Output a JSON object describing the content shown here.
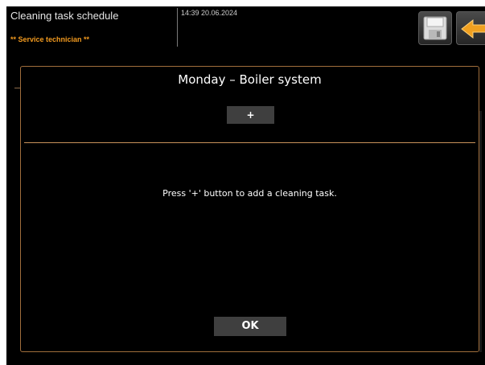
{
  "header": {
    "title": "Cleaning task schedule",
    "role": "** Service technician **",
    "clock": "14:39 20.06.2024",
    "icons": {
      "save": "floppy-disk-icon",
      "back": "back-arrow-icon"
    }
  },
  "dialog": {
    "title": "Monday – Boiler system",
    "add_label": "+",
    "empty_message": "Press '+' button to add a cleaning task.",
    "ok_label": "OK"
  },
  "colors": {
    "accent": "#f29a1f",
    "dialog_border": "#a06e3c",
    "separator": "#c9925a",
    "button": "#3f3f3f",
    "background": "#000000"
  }
}
